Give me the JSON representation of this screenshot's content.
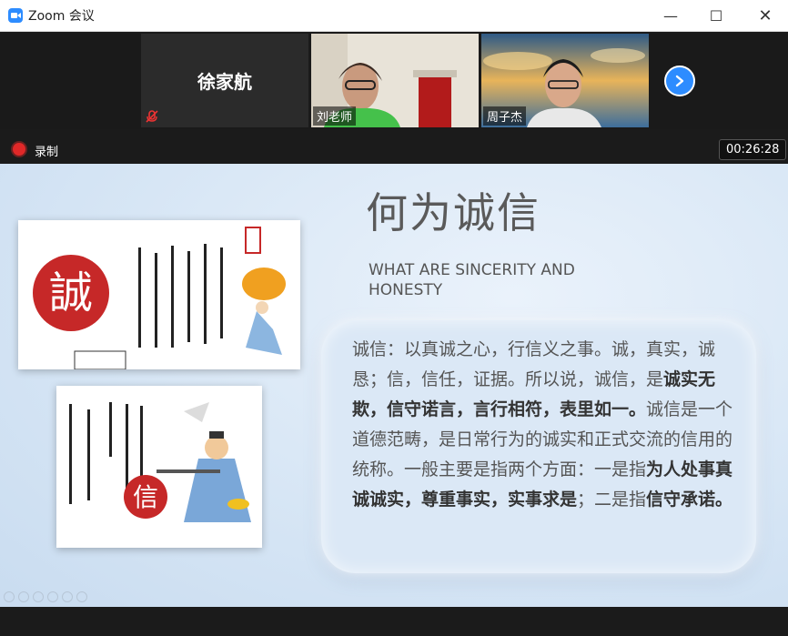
{
  "window": {
    "title": "Zoom 会议",
    "minimize": "—",
    "maximize": "☐",
    "close": "✕"
  },
  "participants": [
    {
      "name": "徐家航",
      "muted": true
    },
    {
      "label": "刘老师"
    },
    {
      "label": "周子杰"
    }
  ],
  "recording": {
    "label": "录制",
    "time": "00:26:28"
  },
  "slide": {
    "title": "何为诚信",
    "subtitle": "WHAT ARE SINCERITY AND HONESTY",
    "img1_char": "誠",
    "img2_char": "信",
    "body": [
      {
        "text": "诚信：以真诚之心，行信义之事。诚，真实，诚恳；信，信任，证据。所以说，诚信，是",
        "bold": false
      },
      {
        "text": "诚实无欺，信守诺言，言行相符，表里如一。",
        "bold": true
      },
      {
        "text": "诚信是一个道德范畴，是日常行为的诚实和正式交流的信用的统称。一般主要是指两个方面：一是指",
        "bold": false
      },
      {
        "text": "为人处事真诚诚实，尊重事实，实事求是",
        "bold": true
      },
      {
        "text": "；二是指",
        "bold": false
      },
      {
        "text": "信守承诺。",
        "bold": true
      }
    ]
  },
  "colors": {
    "accent": "#2d8cff",
    "record": "#e02828",
    "seal": "#c62828"
  }
}
